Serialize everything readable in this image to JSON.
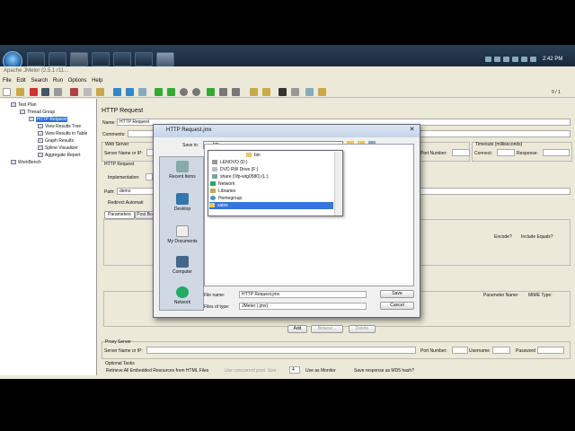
{
  "taskbar": {
    "clock": "2:42 PM"
  },
  "window": {
    "title": "Apache JMeter (2.5.1 r11...",
    "menus": [
      "File",
      "Edit",
      "Search",
      "Run",
      "Options",
      "Help"
    ],
    "counter": "0 / 1"
  },
  "tree": {
    "items": [
      "Test Plan",
      "Thread Group",
      "HTTP Request",
      "View Results Tree",
      "View Results in Table",
      "Graph Results",
      "Spline Visualizer",
      "Aggregate Report",
      "WorkBench"
    ]
  },
  "panel": {
    "title": "HTTP Request",
    "name_label": "Name:",
    "name_value": "HTTP Request",
    "comments_label": "Comments:",
    "web_server": "Web Server",
    "server_label": "Server Name or IP:",
    "port_label": "Port Number:",
    "timeouts": "Timeouts (milliseconds)",
    "connect_label": "Connect:",
    "response_label": "Response:",
    "http_request": "HTTP Request",
    "impl_label": "Implementation:",
    "path_label": "Path:",
    "path_value": "demo",
    "redirect_label": "Redirect Automati",
    "tab_params": "Parameters",
    "tab_post": "Post Bo",
    "col_encode": "Encode?",
    "col_include": "Include Equals?",
    "col_param_name": "Parameter Name:",
    "col_mime": "MIME Type:",
    "add": "Add",
    "browse": "Browse...",
    "delete": "Delete",
    "proxy": "Proxy Server",
    "proxy_server_label": "Server Name or IP:",
    "proxy_port_label": "Port Number:",
    "username_label": "Username",
    "password_label": "Password",
    "optional": "Optional Tasks",
    "opt_retrieve": "Retrieve All Embedded Resources from HTML Files",
    "opt_pool": "Use concurrent pool. Size:",
    "opt_size": "4",
    "opt_monitor": "Use as Monitor",
    "opt_md5": "Save response as MD5 hash?"
  },
  "dialog": {
    "title": "HTTP Request.jmx",
    "save_in_label": "Save in:",
    "save_in_value": "bin",
    "places": [
      "Recent Items",
      "Desktop",
      "My Documents",
      "Computer",
      "Network"
    ],
    "dropdown": [
      "bin",
      "LENOVO (D:)",
      "DVD RW Drive (F:)",
      "share (\\\\fp-wtg0580) (L:)",
      "Network",
      "Libraries",
      "Homegroup",
      "sales"
    ],
    "file_name_label": "File name:",
    "file_name_value": "HTTP Request.jmx",
    "file_type_label": "Files of type:",
    "file_type_value": "JMeter (.jmx)",
    "save": "Save",
    "cancel": "Cancel"
  }
}
